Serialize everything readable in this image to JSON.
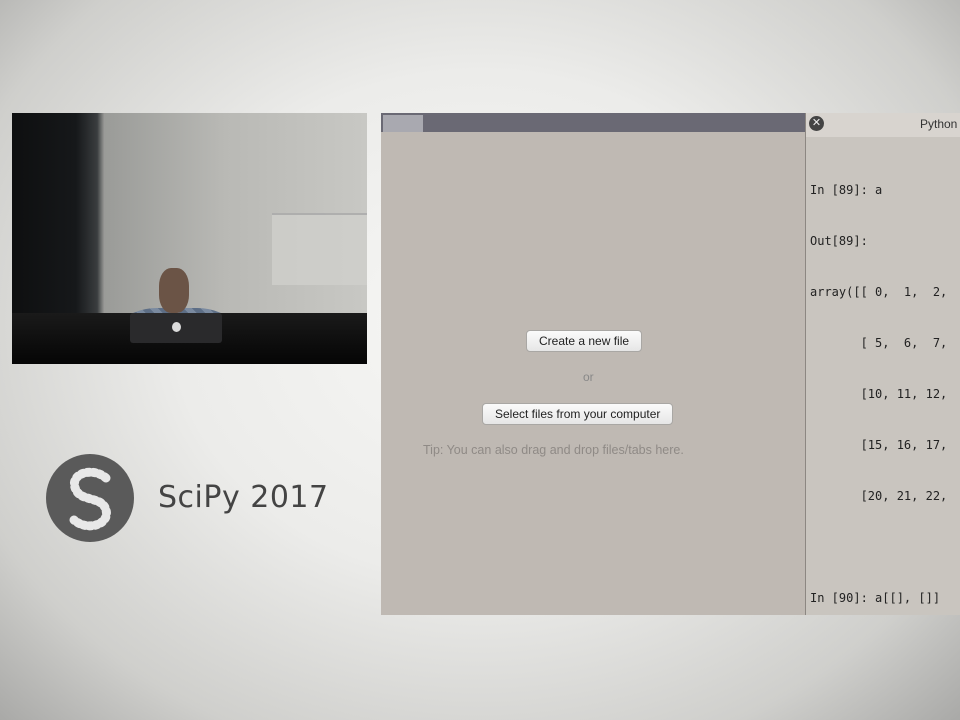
{
  "brand": {
    "name": "SciPy 2017"
  },
  "launcher": {
    "create_label": "Create a new file",
    "or_label": "or",
    "select_label": "Select files from your computer",
    "tip": "Tip: You can also drag and drop files/tabs here."
  },
  "console": {
    "title": "Python",
    "lines": [
      "In [89]: a",
      "Out[89]:",
      "array([[ 0,  1,  2,",
      "       [ 5,  6,  7,",
      "       [10, 11, 12,",
      "       [15, 16, 17,",
      "       [20, 21, 22,",
      "",
      "In [90]: a[[], []]"
    ]
  },
  "icons": {
    "close": "close-icon",
    "logo": "scipy-logo"
  },
  "colors": {
    "panel": "#bfb9b3",
    "tabbar": "#6a6974",
    "console": "#c9c5bf"
  }
}
